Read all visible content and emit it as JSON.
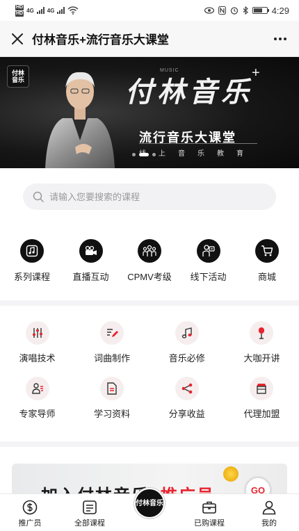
{
  "status_bar": {
    "network1": "4G",
    "network2": "4G",
    "hd1": "HD",
    "hd2": "HD",
    "time": "4:29"
  },
  "header": {
    "title": "付林音乐+流行音乐大课堂"
  },
  "banner": {
    "logo_text": "付林音乐",
    "brand": "付林音乐",
    "plus": "+",
    "music_tag": "MUSIC",
    "subtitle": "流行音乐大课堂",
    "tagline": "线上音乐教育"
  },
  "search": {
    "placeholder": "请输入您要搜索的课程"
  },
  "categories": [
    {
      "label": "系列课程",
      "icon": "music-note-box-icon"
    },
    {
      "label": "直播互动",
      "icon": "video-camera-icon"
    },
    {
      "label": "CPMV考级",
      "icon": "group-people-icon"
    },
    {
      "label": "线下活动",
      "icon": "event-person-icon"
    },
    {
      "label": "商城",
      "icon": "shopping-cart-icon"
    }
  ],
  "features": [
    {
      "label": "演唱技术",
      "icon": "equalizer-icon"
    },
    {
      "label": "词曲制作",
      "icon": "pen-write-icon"
    },
    {
      "label": "音乐必修",
      "icon": "music-note-icon"
    },
    {
      "label": "大咖开讲",
      "icon": "microphone-icon"
    },
    {
      "label": "专家导师",
      "icon": "expert-person-icon"
    },
    {
      "label": "学习资料",
      "icon": "document-icon"
    },
    {
      "label": "分享收益",
      "icon": "share-icon"
    },
    {
      "label": "代理加盟",
      "icon": "store-icon"
    }
  ],
  "promo": {
    "text_main": "加入付林音乐+",
    "text_highlight": "推广员",
    "go": "GO"
  },
  "tabbar": [
    {
      "label": "推广员",
      "icon": "dollar-circle-icon"
    },
    {
      "label": "全部课程",
      "icon": "list-box-icon"
    },
    {
      "label": "付林音乐",
      "icon": "brand-logo-icon"
    },
    {
      "label": "已购课程",
      "icon": "briefcase-icon"
    },
    {
      "label": "我的",
      "icon": "user-icon"
    }
  ],
  "colors": {
    "accent_red": "#e8232f",
    "dark": "#111111",
    "feature_bg": "#f6eeee"
  }
}
